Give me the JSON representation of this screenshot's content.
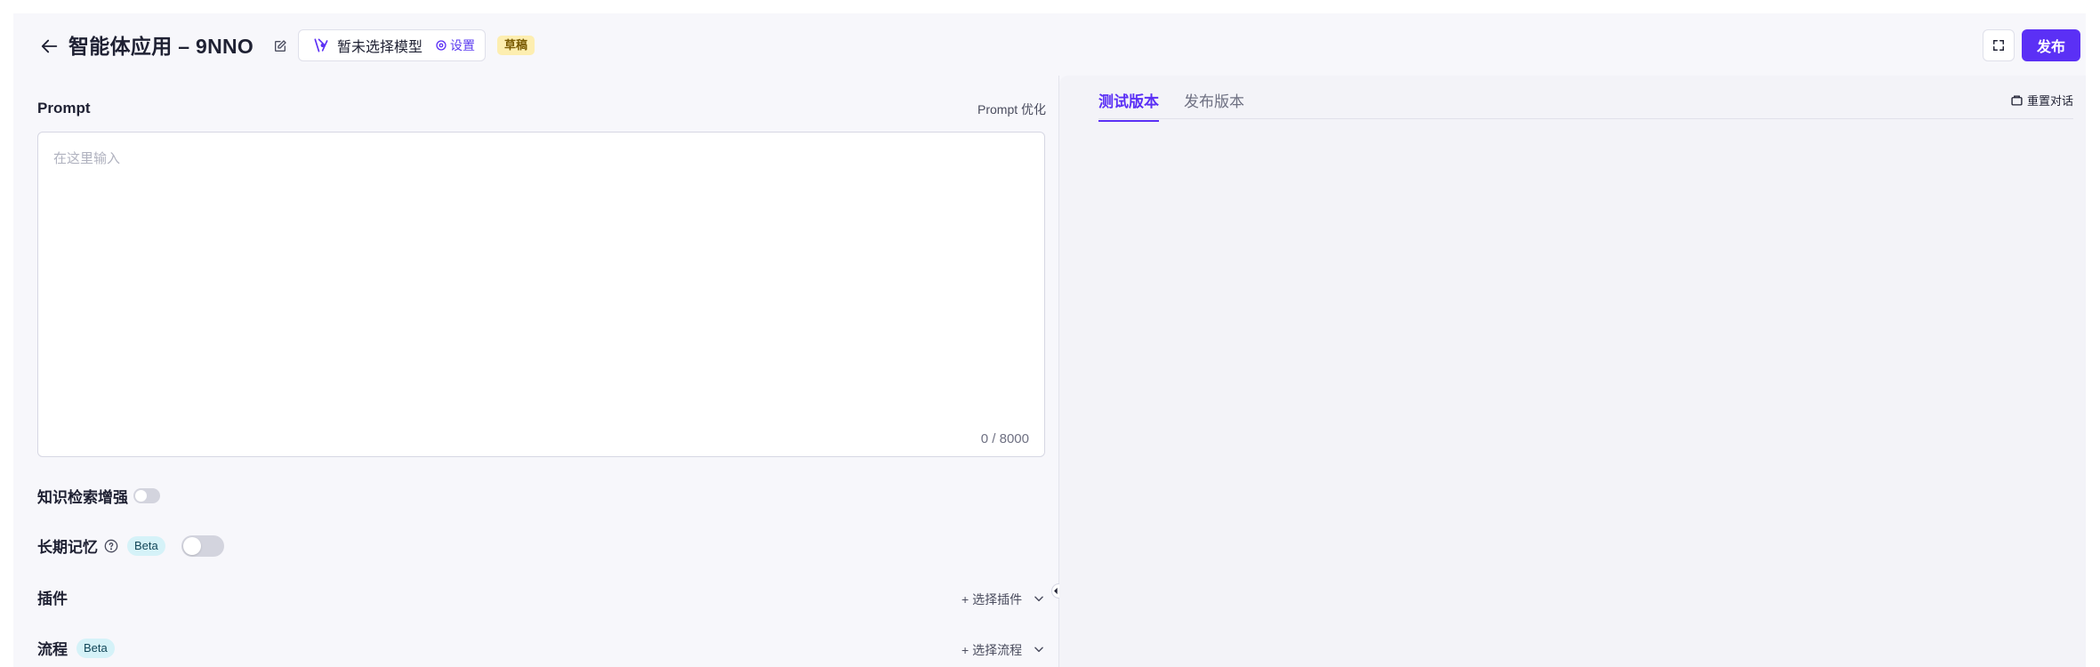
{
  "header": {
    "title": "智能体应用 – 9NNO",
    "model_name": "暂未选择模型",
    "settings_label": "设置",
    "draft_badge": "草稿",
    "publish_label": "发布"
  },
  "prompt": {
    "label": "Prompt",
    "optimize_label": "Prompt 优化",
    "placeholder": "在这里输入",
    "value": "",
    "char_count": "0 / 8000"
  },
  "knowledge": {
    "label": "知识检索增强",
    "enabled": false
  },
  "memory": {
    "label": "长期记忆",
    "beta_label": "Beta",
    "enabled": false
  },
  "plugins": {
    "label": "插件",
    "add_label": "+ 选择插件"
  },
  "flows": {
    "label": "流程",
    "beta_label": "Beta",
    "add_label": "+ 选择流程"
  },
  "preview": {
    "tabs": [
      {
        "label": "测试版本",
        "active": true
      },
      {
        "label": "发布版本",
        "active": false
      }
    ],
    "reset_label": "重置对话"
  },
  "colors": {
    "accent": "#5b30f5",
    "draft_badge_bg": "#fdeeb0",
    "beta_badge_bg": "#d5f2f8"
  }
}
